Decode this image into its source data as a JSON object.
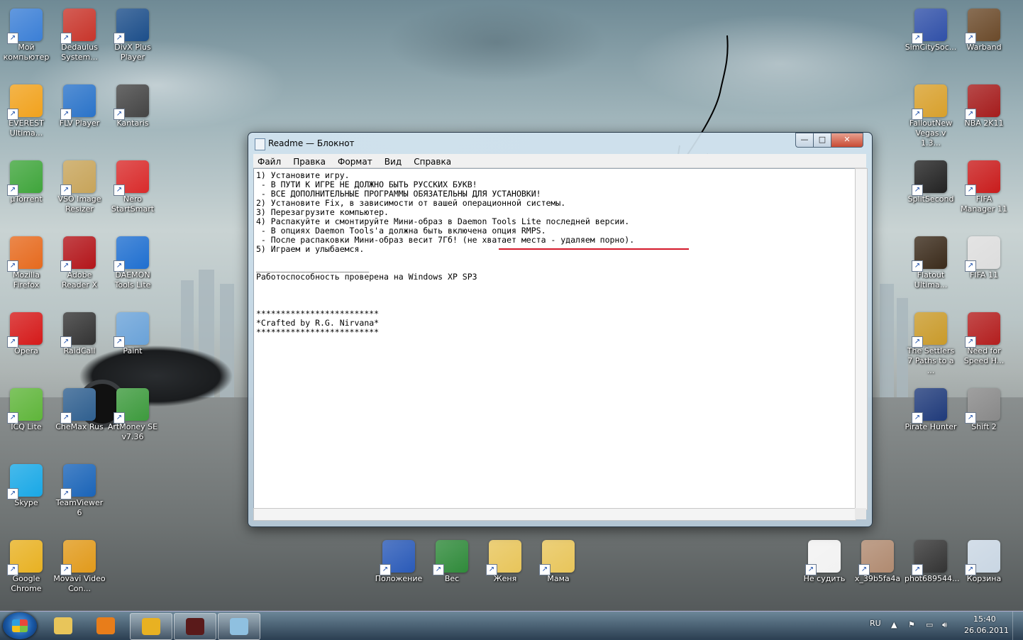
{
  "desktop": {
    "icons_left": [
      {
        "label": "Мой компьютер",
        "icon": "computer-icon",
        "color": "#3b7fd6"
      },
      {
        "label": "Dedaulus System...",
        "icon": "dedalus-icon",
        "color": "#c8352b"
      },
      {
        "label": "DivX Plus Player",
        "icon": "divx-icon",
        "color": "#1c4e8a"
      },
      {
        "label": "EVEREST Ultima...",
        "icon": "everest-icon",
        "color": "#f1a21d"
      },
      {
        "label": "FLV Player",
        "icon": "flv-icon",
        "color": "#2a73c9"
      },
      {
        "label": "Kantaris",
        "icon": "kantaris-icon",
        "color": "#444444"
      },
      {
        "label": "µTorrent",
        "icon": "utorrent-icon",
        "color": "#3fa53b"
      },
      {
        "label": "VSO Image Resizer",
        "icon": "vso-icon",
        "color": "#c7a45a"
      },
      {
        "label": "Nero StartSmart",
        "icon": "nero-icon",
        "color": "#d92b2b"
      },
      {
        "label": "Mozilla Firefox",
        "icon": "firefox-icon",
        "color": "#e66a1e"
      },
      {
        "label": "Adobe Reader X",
        "icon": "adobe-icon",
        "color": "#b3151a"
      },
      {
        "label": "DAEMON Tools Lite",
        "icon": "daemon-icon",
        "color": "#1f6fd0"
      },
      {
        "label": "Opera",
        "icon": "opera-icon",
        "color": "#d51a1a"
      },
      {
        "label": "RaidCall",
        "icon": "raidcall-icon",
        "color": "#333333"
      },
      {
        "label": "Paint",
        "icon": "paint-icon",
        "color": "#6aa2d8"
      },
      {
        "label": "ICQ Lite",
        "icon": "icq-icon",
        "color": "#5fb53a"
      },
      {
        "label": "CheMax Rus",
        "icon": "chemax-icon",
        "color": "#2f5f8f"
      },
      {
        "label": "ArtMoney SE v7.36",
        "icon": "artmoney-icon",
        "color": "#3d9a3d"
      },
      {
        "label": "Skype",
        "icon": "skype-icon",
        "color": "#19a8e6"
      },
      {
        "label": "TeamViewer 6",
        "icon": "teamviewer-icon",
        "color": "#1a64b8"
      },
      {
        "label": "Google Chrome",
        "icon": "chrome-icon",
        "color": "#e8b122"
      },
      {
        "label": "Movavi Video Con...",
        "icon": "movavi-icon",
        "color": "#e19a1b"
      }
    ],
    "icons_right": [
      {
        "label": "SimCitySoc...",
        "icon": "simcity-icon",
        "color": "#3050a8"
      },
      {
        "label": "Warband",
        "icon": "warband-icon",
        "color": "#6b4a2a"
      },
      {
        "label": "FalloutNew Vegas.v 1.3...",
        "icon": "fallout-icon",
        "color": "#d8a02c"
      },
      {
        "label": "NBA 2K11",
        "icon": "nba-icon",
        "color": "#a51c1c"
      },
      {
        "label": "SplitSecond",
        "icon": "splitsecond-icon",
        "color": "#222222"
      },
      {
        "label": "FIFA Manager 11",
        "icon": "fifamanager-icon",
        "color": "#c91c1c"
      },
      {
        "label": "Flatout Ultima...",
        "icon": "flatout-icon",
        "color": "#3a2a1a"
      },
      {
        "label": "FIFA 11",
        "icon": "fifa-icon",
        "color": "#dddddd"
      },
      {
        "label": "The Settlers 7 Paths to a ...",
        "icon": "settlers-icon",
        "color": "#c99a2a"
      },
      {
        "label": "Need for Speed H...",
        "icon": "nfs-icon",
        "color": "#b31e1e"
      },
      {
        "label": "Pirate Hunter",
        "icon": "pirate-icon",
        "color": "#1f3a7a"
      },
      {
        "label": "Shift 2",
        "icon": "shift-icon",
        "color": "#888888"
      }
    ],
    "icons_bottom": [
      {
        "label": "Положение",
        "icon": "word-doc-icon",
        "color": "#2a5ab8"
      },
      {
        "label": "Вес",
        "icon": "excel-doc-icon",
        "color": "#2f8a3a"
      },
      {
        "label": "Женя",
        "icon": "folder-icon",
        "color": "#e8c55a"
      },
      {
        "label": "Мама",
        "icon": "folder-icon",
        "color": "#e8c55a"
      },
      {
        "label": "Не судить",
        "icon": "blank-doc-icon",
        "color": "#f2f2f2"
      },
      {
        "label": "x_39b5fa4a",
        "icon": "image-thumb-icon",
        "color": "#b08a70"
      },
      {
        "label": "phot689544...",
        "icon": "image-thumb-icon",
        "color": "#333333"
      },
      {
        "label": "Корзина",
        "icon": "recycle-bin-icon",
        "color": "#c9d6e3"
      }
    ]
  },
  "notepad": {
    "title": "Readme — Блокнот",
    "buttons": {
      "min": "—",
      "max": "□",
      "close": "✕"
    },
    "menu": [
      "Файл",
      "Правка",
      "Формат",
      "Вид",
      "Справка"
    ],
    "lines": [
      "1) Установите игру.",
      " - В ПУТИ К ИГРЕ НЕ ДОЛЖНО БЫТЬ РУССКИХ БУКВ!",
      " - ВСЕ ДОПОЛНИТЕЛЬНЫЕ ПРОГРАММЫ ОБЯЗАТЕЛЬНЫ ДЛЯ УСТАНОВКИ!",
      "2) Установите Fix, в зависимости от вашей операционной системы.",
      "3) Перезагрузите компьютер.",
      "4) Распакуйте и смонтируйте Мини-образ в Daemon Tools Lite последней версии.",
      " - В опциях Daemon Tools'а должна быть включена опция RMPS.",
      " - После распаковки Мини-образ весит 7Гб! (не хватает места - удаляем порно).",
      "5) Играем и улыбаемся.",
      "",
      "_______________________",
      "Работоспособность проверена на Windows XP SP3",
      "",
      "",
      "",
      "*************************",
      "*Crafted by R.G. Nirvana*",
      "*************************"
    ]
  },
  "taskbar": {
    "lang": "RU",
    "time": "15:40",
    "date": "26.06.2011",
    "pinned": [
      {
        "icon": "explorer-icon",
        "color": "#e8c55a"
      },
      {
        "icon": "media-player-icon",
        "color": "#e87d1a"
      },
      {
        "icon": "chrome-icon",
        "color": "#e8b122"
      },
      {
        "icon": "game-icon",
        "color": "#5a1a1a"
      },
      {
        "icon": "notepad-icon",
        "color": "#8fc0e0"
      }
    ]
  }
}
